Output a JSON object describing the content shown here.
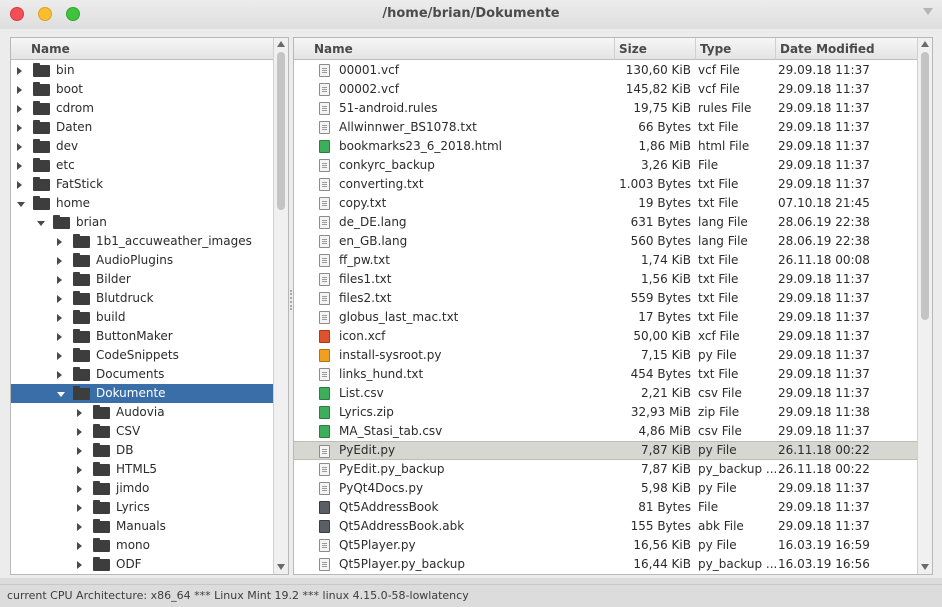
{
  "window": {
    "title": "/home/brian/Dokumente"
  },
  "tree": {
    "header": "Name",
    "rows": [
      {
        "label": "bin",
        "depth": 0,
        "state": "collapsed"
      },
      {
        "label": "boot",
        "depth": 0,
        "state": "collapsed"
      },
      {
        "label": "cdrom",
        "depth": 0,
        "state": "collapsed"
      },
      {
        "label": "Daten",
        "depth": 0,
        "state": "collapsed"
      },
      {
        "label": "dev",
        "depth": 0,
        "state": "collapsed"
      },
      {
        "label": "etc",
        "depth": 0,
        "state": "collapsed"
      },
      {
        "label": "FatStick",
        "depth": 0,
        "state": "collapsed"
      },
      {
        "label": "home",
        "depth": 0,
        "state": "expanded"
      },
      {
        "label": "brian",
        "depth": 1,
        "state": "expanded"
      },
      {
        "label": "1b1_accuweather_images",
        "depth": 2,
        "state": "collapsed"
      },
      {
        "label": "AudioPlugins",
        "depth": 2,
        "state": "collapsed"
      },
      {
        "label": "Bilder",
        "depth": 2,
        "state": "collapsed"
      },
      {
        "label": "Blutdruck",
        "depth": 2,
        "state": "collapsed"
      },
      {
        "label": "build",
        "depth": 2,
        "state": "collapsed"
      },
      {
        "label": "ButtonMaker",
        "depth": 2,
        "state": "collapsed"
      },
      {
        "label": "CodeSnippets",
        "depth": 2,
        "state": "collapsed"
      },
      {
        "label": "Documents",
        "depth": 2,
        "state": "collapsed"
      },
      {
        "label": "Dokumente",
        "depth": 2,
        "state": "expanded",
        "selected": true
      },
      {
        "label": "Audovia",
        "depth": 3,
        "state": "collapsed"
      },
      {
        "label": "CSV",
        "depth": 3,
        "state": "collapsed"
      },
      {
        "label": "DB",
        "depth": 3,
        "state": "collapsed"
      },
      {
        "label": "HTML5",
        "depth": 3,
        "state": "collapsed"
      },
      {
        "label": "jimdo",
        "depth": 3,
        "state": "collapsed"
      },
      {
        "label": "Lyrics",
        "depth": 3,
        "state": "collapsed"
      },
      {
        "label": "Manuals",
        "depth": 3,
        "state": "collapsed"
      },
      {
        "label": "mono",
        "depth": 3,
        "state": "collapsed"
      },
      {
        "label": "ODF",
        "depth": 3,
        "state": "collapsed"
      }
    ]
  },
  "files": {
    "headers": {
      "name": "Name",
      "size": "Size",
      "type": "Type",
      "date": "Date Modified"
    },
    "rows": [
      {
        "name": "00001.vcf",
        "size": "130,60 KiB",
        "type": "vcf File",
        "date": "29.09.18 11:37",
        "icon": "text-file-icon"
      },
      {
        "name": "00002.vcf",
        "size": "145,82 KiB",
        "type": "vcf File",
        "date": "29.09.18 11:37",
        "icon": "text-file-icon"
      },
      {
        "name": "51-android.rules",
        "size": "19,75 KiB",
        "type": "rules File",
        "date": "29.09.18 11:37",
        "icon": "text-file-icon"
      },
      {
        "name": "Allwinnwer_BS1078.txt",
        "size": "66 Bytes",
        "type": "txt File",
        "date": "29.09.18 11:37",
        "icon": "text-file-icon"
      },
      {
        "name": "bookmarks23_6_2018.html",
        "size": "1,86 MiB",
        "type": "html File",
        "date": "29.09.18 11:37",
        "icon": "html-file-icon"
      },
      {
        "name": "conkyrc_backup",
        "size": "3,26 KiB",
        "type": "File",
        "date": "29.09.18 11:37",
        "icon": "text-file-icon"
      },
      {
        "name": "converting.txt",
        "size": "1.003 Bytes",
        "type": "txt File",
        "date": "29.09.18 11:37",
        "icon": "text-file-icon"
      },
      {
        "name": "copy.txt",
        "size": "19 Bytes",
        "type": "txt File",
        "date": "07.10.18 21:45",
        "icon": "text-file-icon"
      },
      {
        "name": "de_DE.lang",
        "size": "631 Bytes",
        "type": "lang File",
        "date": "28.06.19 22:38",
        "icon": "text-file-icon"
      },
      {
        "name": "en_GB.lang",
        "size": "560 Bytes",
        "type": "lang File",
        "date": "28.06.19 22:38",
        "icon": "text-file-icon"
      },
      {
        "name": "ff_pw.txt",
        "size": "1,74 KiB",
        "type": "txt File",
        "date": "26.11.18 00:08",
        "icon": "text-file-icon"
      },
      {
        "name": "files1.txt",
        "size": "1,56 KiB",
        "type": "txt File",
        "date": "29.09.18 11:37",
        "icon": "text-file-icon"
      },
      {
        "name": "files2.txt",
        "size": "559 Bytes",
        "type": "txt File",
        "date": "29.09.18 11:37",
        "icon": "text-file-icon"
      },
      {
        "name": "globus_last_mac.txt",
        "size": "17 Bytes",
        "type": "txt File",
        "date": "29.09.18 11:37",
        "icon": "text-file-icon"
      },
      {
        "name": "icon.xcf",
        "size": "50,00 KiB",
        "type": "xcf File",
        "date": "29.09.18 11:37",
        "icon": "image-file-icon"
      },
      {
        "name": "install-sysroot.py",
        "size": "7,15 KiB",
        "type": "py File",
        "date": "29.09.18 11:37",
        "icon": "script-file-icon"
      },
      {
        "name": "links_hund.txt",
        "size": "454 Bytes",
        "type": "txt File",
        "date": "29.09.18 11:37",
        "icon": "text-file-icon"
      },
      {
        "name": "List.csv",
        "size": "2,21 KiB",
        "type": "csv File",
        "date": "29.09.18 11:37",
        "icon": "spreadsheet-file-icon"
      },
      {
        "name": "Lyrics.zip",
        "size": "32,93 MiB",
        "type": "zip File",
        "date": "29.09.18 11:38",
        "icon": "archive-file-icon"
      },
      {
        "name": "MA_Stasi_tab.csv",
        "size": "4,86 MiB",
        "type": "csv File",
        "date": "29.09.18 11:37",
        "icon": "spreadsheet-file-icon"
      },
      {
        "name": "PyEdit.py",
        "size": "7,87 KiB",
        "type": "py File",
        "date": "26.11.18 00:22",
        "icon": "text-file-icon",
        "highlighted": true
      },
      {
        "name": "PyEdit.py_backup",
        "size": "7,87 KiB",
        "type": "py_backup ...",
        "date": "26.11.18 00:22",
        "icon": "text-file-icon"
      },
      {
        "name": "PyQt4Docs.py",
        "size": "5,98 KiB",
        "type": "py File",
        "date": "29.09.18 11:37",
        "icon": "text-file-icon"
      },
      {
        "name": "Qt5AddressBook",
        "size": "81 Bytes",
        "type": "File",
        "date": "29.09.18 11:37",
        "icon": "binary-file-icon"
      },
      {
        "name": "Qt5AddressBook.abk",
        "size": "155 Bytes",
        "type": "abk File",
        "date": "29.09.18 11:37",
        "icon": "binary-file-icon"
      },
      {
        "name": "Qt5Player.py",
        "size": "16,56 KiB",
        "type": "py File",
        "date": "16.03.19 16:59",
        "icon": "text-file-icon"
      },
      {
        "name": "Qt5Player.py_backup",
        "size": "16,44 KiB",
        "type": "py_backup ...",
        "date": "16.03.19 16:56",
        "icon": "text-file-icon"
      }
    ]
  },
  "status": {
    "text": "current CPU Architecture: x86_64 *** Linux Mint 19.2 *** linux 4.15.0-58-lowlatency"
  },
  "colors": {
    "selection": "#3a6ea8",
    "highlight": "#d7d7d2",
    "close": "#f25056",
    "minimize": "#f9be2f",
    "maximize": "#3fc23d"
  }
}
